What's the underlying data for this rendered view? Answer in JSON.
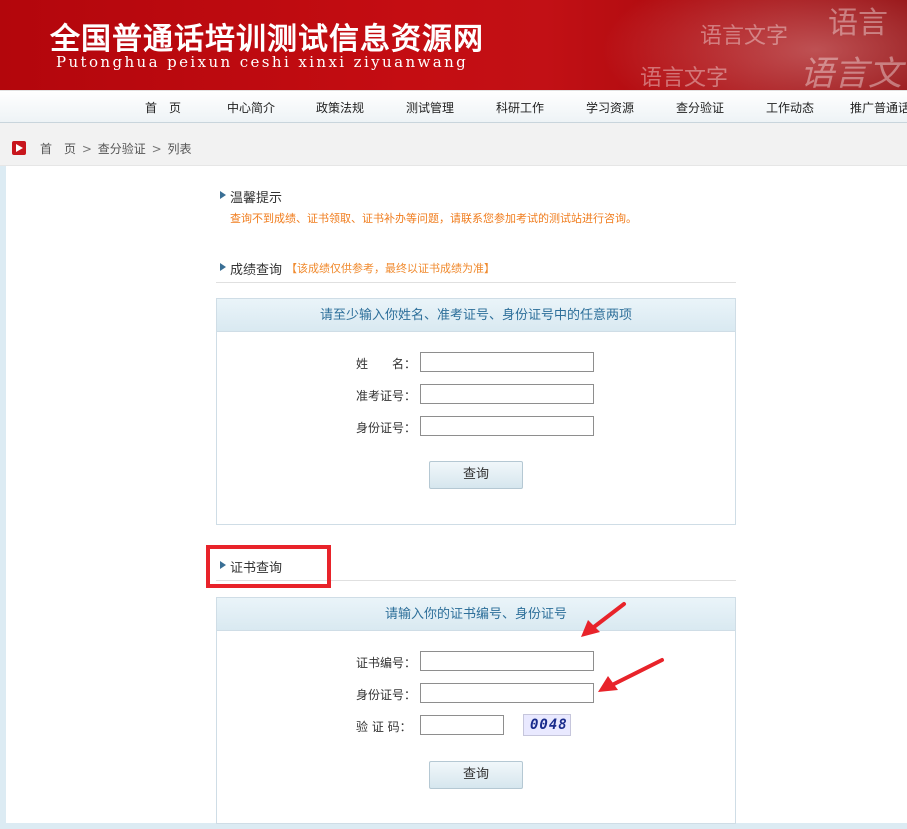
{
  "header": {
    "title": "全国普通话培训测试信息资源网",
    "subtitle": "Putonghua peixun ceshi xinxi ziyuanwang",
    "watermark_text": [
      "语言文字",
      "语言",
      "语言文字",
      "语言文"
    ]
  },
  "nav": {
    "items": [
      "首　页",
      "中心简介",
      "政策法规",
      "测试管理",
      "科研工作",
      "学习资源",
      "查分验证",
      "工作动态",
      "推广普通话"
    ]
  },
  "breadcrumb": {
    "home": "首　页",
    "section": "查分验证",
    "current": "列表",
    "separator": ">"
  },
  "tip": {
    "title": "温馨提示",
    "text": "查询不到成绩、证书领取、证书补办等问题，请联系您参加考试的测试站进行咨询。"
  },
  "score_query": {
    "title": "成绩查询",
    "note": "【该成绩仅供参考，最终以证书成绩为准】",
    "panel_title": "请至少输入你姓名、准考证号、身份证号中的任意两项",
    "fields": {
      "name": "姓　　名：",
      "exam_id": "准考证号：",
      "id_number": "身份证号："
    },
    "values": {
      "name": "",
      "exam_id": "",
      "id_number": ""
    },
    "button": "查询"
  },
  "cert_query": {
    "title": "证书查询",
    "panel_title": "请输入你的证书编号、身份证号",
    "fields": {
      "cert_number": "证书编号：",
      "id_number": "身份证号：",
      "captcha": "验 证 码："
    },
    "values": {
      "cert_number": "",
      "id_number": "",
      "captcha": ""
    },
    "captcha_image_text": "0048",
    "button": "查询"
  },
  "colors": {
    "banner_red": "#c40d12",
    "highlight_red": "#e8232a",
    "tip_orange": "#f07d1e",
    "panel_title_blue": "#2d6f9a"
  }
}
